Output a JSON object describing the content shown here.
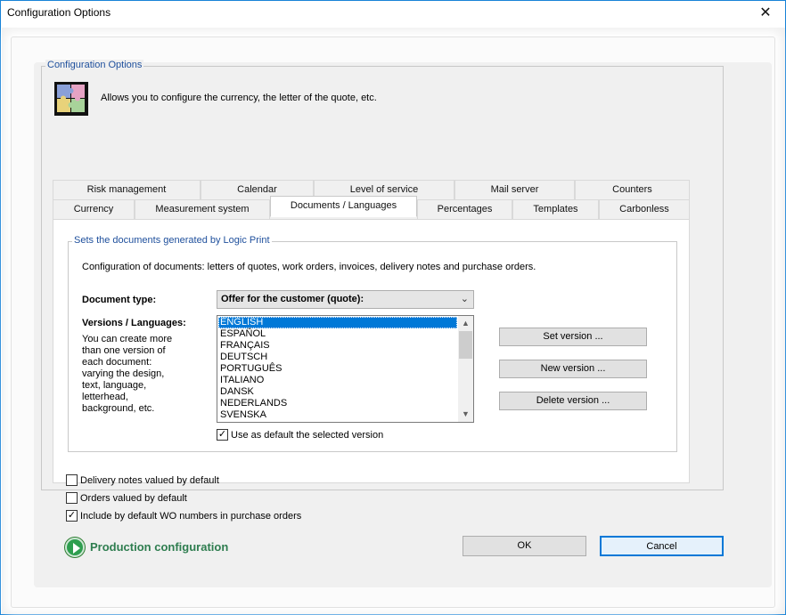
{
  "window": {
    "title": "Configuration Options",
    "close_glyph": "✕"
  },
  "group": {
    "legend": "Configuration Options",
    "description": "Allows you to configure the currency, the letter of the quote, etc.",
    "icon": "puzzle-icon"
  },
  "tabs_row1": [
    "Risk management",
    "Calendar",
    "Level of service",
    "Mail server",
    "Counters"
  ],
  "tabs_row2": [
    "Currency",
    "Measurement system",
    "Documents / Languages",
    "Percentages",
    "Templates",
    "Carbonless"
  ],
  "active_tab": "Documents / Languages",
  "docs": {
    "legend": "Sets the documents generated by Logic Print",
    "intro": "Configuration of documents: letters of quotes, work orders, invoices, delivery notes and purchase orders.",
    "doc_type_label": "Document type:",
    "doc_type_value": "Offer for the customer (quote):",
    "versions_label": "Versions / Languages:",
    "versions_help": [
      "You can create more",
      "than one version of",
      "each document:",
      "varying the design,",
      "text, language,",
      "letterhead,",
      "background, etc."
    ],
    "languages": [
      "ENGLISH",
      "ESPAÑOL",
      "FRANÇAIS",
      "DEUTSCH",
      "PORTUGUÊS",
      "ITALIANO",
      "DANSK",
      "NEDERLANDS",
      "SVENSKA"
    ],
    "selected_language": "ENGLISH",
    "set_version": "Set version ...",
    "new_version": "New version ...",
    "delete_version": "Delete version ...",
    "use_default_label": "Use as default the selected version",
    "use_default_checked": true
  },
  "options": [
    {
      "label": "Delivery notes valued by default",
      "checked": false
    },
    {
      "label": "Orders valued by default",
      "checked": false
    },
    {
      "label": "Include by default WO numbers in purchase orders",
      "checked": true
    }
  ],
  "footer": {
    "production_label": "Production configuration",
    "production_icon": "play-circle-icon",
    "ok": "OK",
    "cancel": "Cancel",
    "accent_color": "#2e7d4f",
    "focus_color": "#0078d7"
  }
}
